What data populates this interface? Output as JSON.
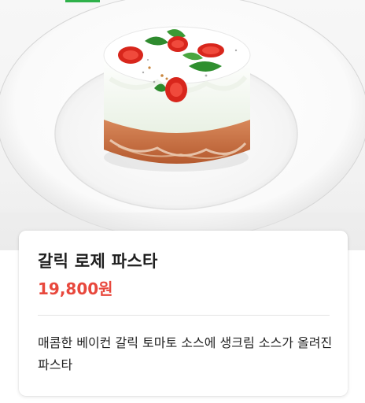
{
  "menu_item": {
    "name": "갈릭 로제 파스타",
    "price": "19,800원",
    "description": "매콤한 베이컨 갈릭 토마토 소스에 생크림 소스가 올려진 파스타",
    "image_icon": "pasta-photo"
  },
  "colors": {
    "price": "#e8483d",
    "tab_indicator": "#2fb14a",
    "divider": "#e4e4e4"
  }
}
